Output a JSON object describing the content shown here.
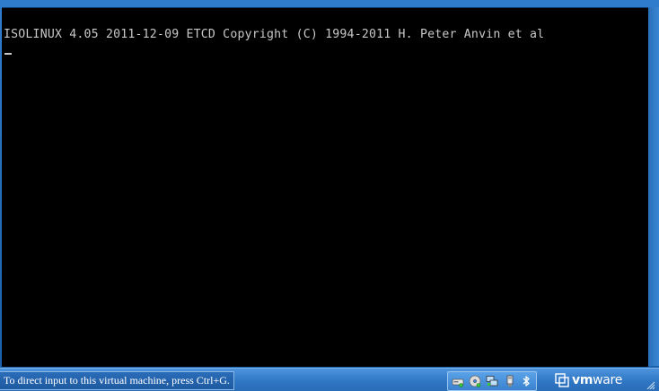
{
  "console": {
    "boot_line": "ISOLINUX 4.05 2011-12-09 ETCD Copyright (C) 1994-2011 H. Peter Anvin et al",
    "cursor_char": "_"
  },
  "statusbar": {
    "hint": "To direct input to this virtual machine, press Ctrl+G.",
    "brand_prefix": "vm",
    "brand_suffix": "ware"
  },
  "devices": [
    {
      "icon": "hard-disk-icon"
    },
    {
      "icon": "cd-dvd-icon"
    },
    {
      "icon": "network-adapter-icon"
    },
    {
      "icon": "usb-device-icon"
    },
    {
      "icon": "bluetooth-icon"
    }
  ],
  "colors": {
    "console_bg": "#000000",
    "console_text": "#c8c8c8",
    "frame_blue": "#1c5fa3",
    "status_text": "#ffffff"
  }
}
